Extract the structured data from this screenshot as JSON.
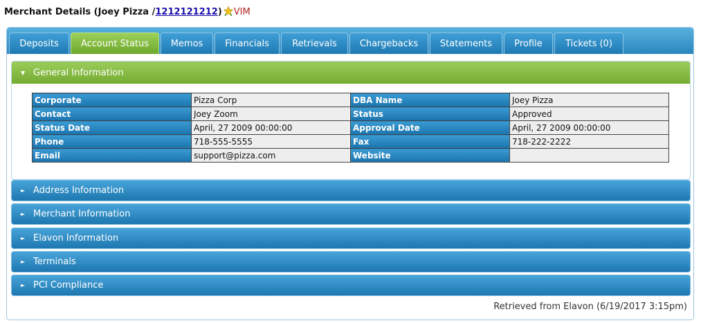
{
  "header": {
    "title_prefix": "Merchant Details (Joey Pizza /",
    "merchant_id": "1212121212",
    "title_suffix": ")",
    "vim_label": "VIM"
  },
  "tabs": [
    {
      "label": "Deposits"
    },
    {
      "label": "Account Status"
    },
    {
      "label": "Memos"
    },
    {
      "label": "Financials"
    },
    {
      "label": "Retrievals"
    },
    {
      "label": "Chargebacks"
    },
    {
      "label": "Statements"
    },
    {
      "label": "Profile"
    },
    {
      "label": "Tickets (0)"
    }
  ],
  "active_tab": "Account Status",
  "general": {
    "title": "General Information",
    "rows": [
      {
        "l1": "Corporate",
        "v1": "Pizza Corp",
        "l2": "DBA Name",
        "v2": "Joey Pizza"
      },
      {
        "l1": "Contact",
        "v1": "Joey Zoom",
        "l2": "Status",
        "v2": "Approved"
      },
      {
        "l1": "Status Date",
        "v1": "April, 27 2009 00:00:00",
        "l2": "Approval Date",
        "v2": "April, 27 2009 00:00:00"
      },
      {
        "l1": "Phone",
        "v1": "718-555-5555",
        "l2": "Fax",
        "v2": "718-222-2222"
      },
      {
        "l1": "Email",
        "v1": "support@pizza.com",
        "l2": "Website",
        "v2": ""
      }
    ]
  },
  "sections": [
    {
      "title": "Address Information"
    },
    {
      "title": "Merchant Information"
    },
    {
      "title": "Elavon Information"
    },
    {
      "title": "Terminals"
    },
    {
      "title": "PCI Compliance"
    }
  ],
  "footer": {
    "text": "Retrieved from Elavon (6/19/2017 3:15pm)"
  },
  "colors": {
    "accent_blue": "#2b86bf",
    "accent_green": "#74ab31",
    "vim_red": "#b02020"
  },
  "icons": {
    "star": "star-icon",
    "expanded": "triangle-down-icon",
    "collapsed": "triangle-right-icon"
  }
}
